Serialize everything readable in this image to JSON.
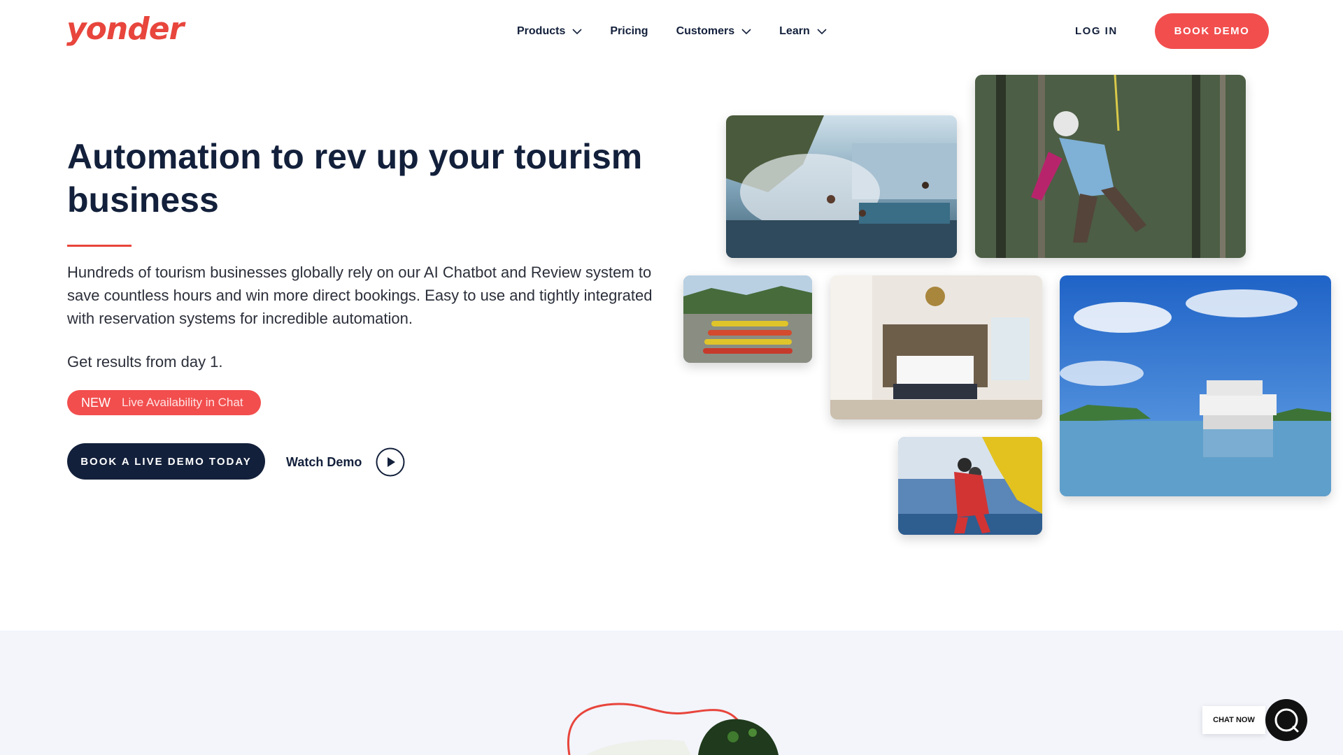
{
  "brand": {
    "logo_text": "yonder",
    "accent_color": "#f24e4e",
    "navy_color": "#13203b"
  },
  "nav": {
    "items": [
      {
        "label": "Products",
        "has_dropdown": true
      },
      {
        "label": "Pricing",
        "has_dropdown": false
      },
      {
        "label": "Customers",
        "has_dropdown": true
      },
      {
        "label": "Learn",
        "has_dropdown": true
      }
    ],
    "login_label": "LOG IN",
    "book_demo_label": "BOOK DEMO"
  },
  "hero": {
    "title": "Automation to rev up your tourism business",
    "description": "Hundreds of tourism businesses globally rely on our AI Chatbot and Review system to save countless hours and win more direct bookings. Easy to use and tightly integrated with reservation systems for incredible automation.",
    "results_text": "Get results from day 1.",
    "badge": {
      "new_label": "NEW",
      "feature_label": "Live Availability in Chat"
    },
    "cta_label": "BOOK A LIVE DEMO TODAY",
    "watch_demo_label": "Watch Demo"
  },
  "gallery": {
    "photos": [
      {
        "name": "hot-springs-photo"
      },
      {
        "name": "zipline-photo"
      },
      {
        "name": "kayaks-photo"
      },
      {
        "name": "hotel-bedroom-photo"
      },
      {
        "name": "catamaran-photo"
      },
      {
        "name": "skydiving-photo"
      }
    ]
  },
  "chat": {
    "label": "CHAT NOW",
    "icon": "chat-bubble-icon"
  }
}
